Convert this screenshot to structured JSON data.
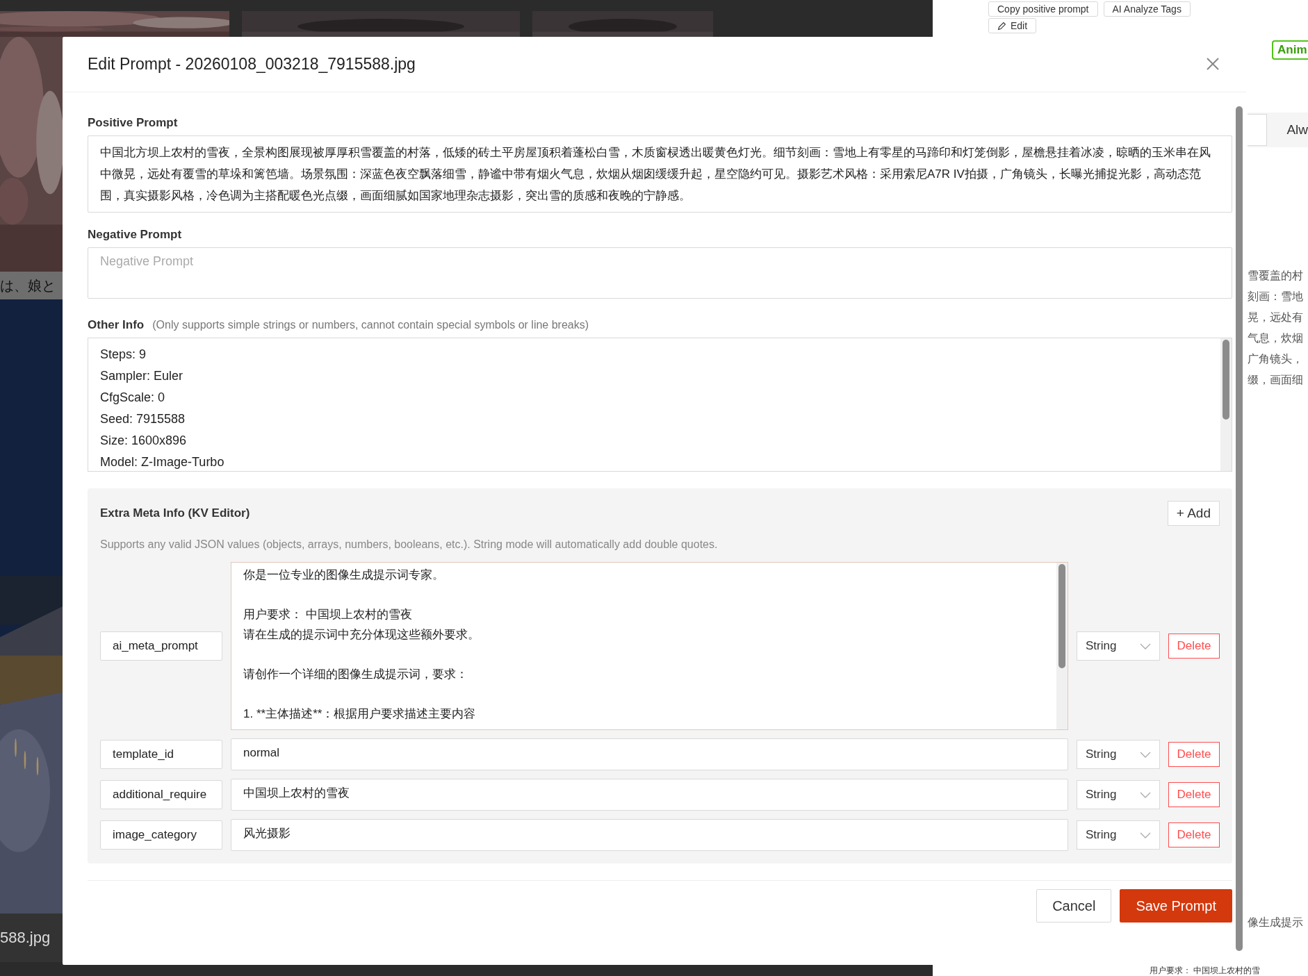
{
  "background": {
    "top_buttons": [
      {
        "label": "Copy positive prompt"
      },
      {
        "label": "AI Analyze Tags"
      }
    ],
    "edit_button": "Edit",
    "tag": "Anim",
    "field_value": "Alw",
    "caption": "は、娘と",
    "filename": "588.jpg",
    "fragments": [
      "雪覆盖的村",
      "刻画：雪地",
      "晃，远处有",
      "气息，炊烟",
      "广角镜头，",
      "缀，画面细"
    ],
    "fragment_lower": "像生成提示",
    "fragment_bottom": "用户要求：  中国坝上农村的雪"
  },
  "dialog": {
    "title": "Edit Prompt - 20260108_003218_7915588.jpg",
    "positive": {
      "label": "Positive Prompt",
      "value": "中国北方坝上农村的雪夜，全景构图展现被厚厚积雪覆盖的村落，低矮的砖土平房屋顶积着蓬松白雪，木质窗棂透出暖黄色灯光。细节刻画：雪地上有零星的马蹄印和灯笼倒影，屋檐悬挂着冰凌，晾晒的玉米串在风中微晃，远处有覆雪的草垛和篱笆墙。场景氛围：深蓝色夜空飘落细雪，静谧中带有烟火气息，炊烟从烟囱缓缓升起，星空隐约可见。摄影艺术风格：采用索尼A7R IV拍摄，广角镜头，长曝光捕捉光影，高动态范围，真实摄影风格，冷色调为主搭配暖色光点缀，画面细腻如国家地理杂志摄影，突出雪的质感和夜晚的宁静感。"
    },
    "negative": {
      "label": "Negative Prompt",
      "placeholder": "Negative Prompt"
    },
    "other_info": {
      "label": "Other Info",
      "hint": "(Only supports simple strings or numbers, cannot contain special symbols or line breaks)",
      "lines": [
        "Steps: 9",
        "Sampler: Euler",
        "CfgScale: 0",
        "Seed: 7915588",
        "Size: 1600x896",
        "Model: Z-Image-Turbo"
      ]
    },
    "extra_meta": {
      "title": "Extra Meta Info (KV Editor)",
      "add_button": "+ Add",
      "hint": "Supports any valid JSON values (objects, arrays, numbers, booleans, etc.). String mode will automatically add double quotes.",
      "rows": [
        {
          "kind": "multiline",
          "key": "ai_meta_prompt",
          "paragraphs": [
            [
              "你是一位专业的图像生成提示词专家。"
            ],
            [
              "用户要求： 中国坝上农村的雪夜",
              "请在生成的提示词中充分体现这些额外要求。"
            ],
            [
              "请创作一个详细的图像生成提示词，要求："
            ],
            [
              "1. **主体描述**：根据用户要求描述主要内容"
            ]
          ],
          "type": "String",
          "delete": "Delete"
        },
        {
          "kind": "single",
          "key": "template_id",
          "value": "normal",
          "type": "String",
          "delete": "Delete"
        },
        {
          "kind": "single",
          "key": "additional_require",
          "value": "中国坝上农村的雪夜",
          "type": "String",
          "delete": "Delete"
        },
        {
          "kind": "single",
          "key": "image_category",
          "value": "风光摄影",
          "type": "String",
          "delete": "Delete"
        }
      ]
    },
    "buttons": [
      {
        "label": "Cancel",
        "kind": "secondary"
      },
      {
        "label": "Save Prompt",
        "kind": "primary"
      }
    ]
  }
}
